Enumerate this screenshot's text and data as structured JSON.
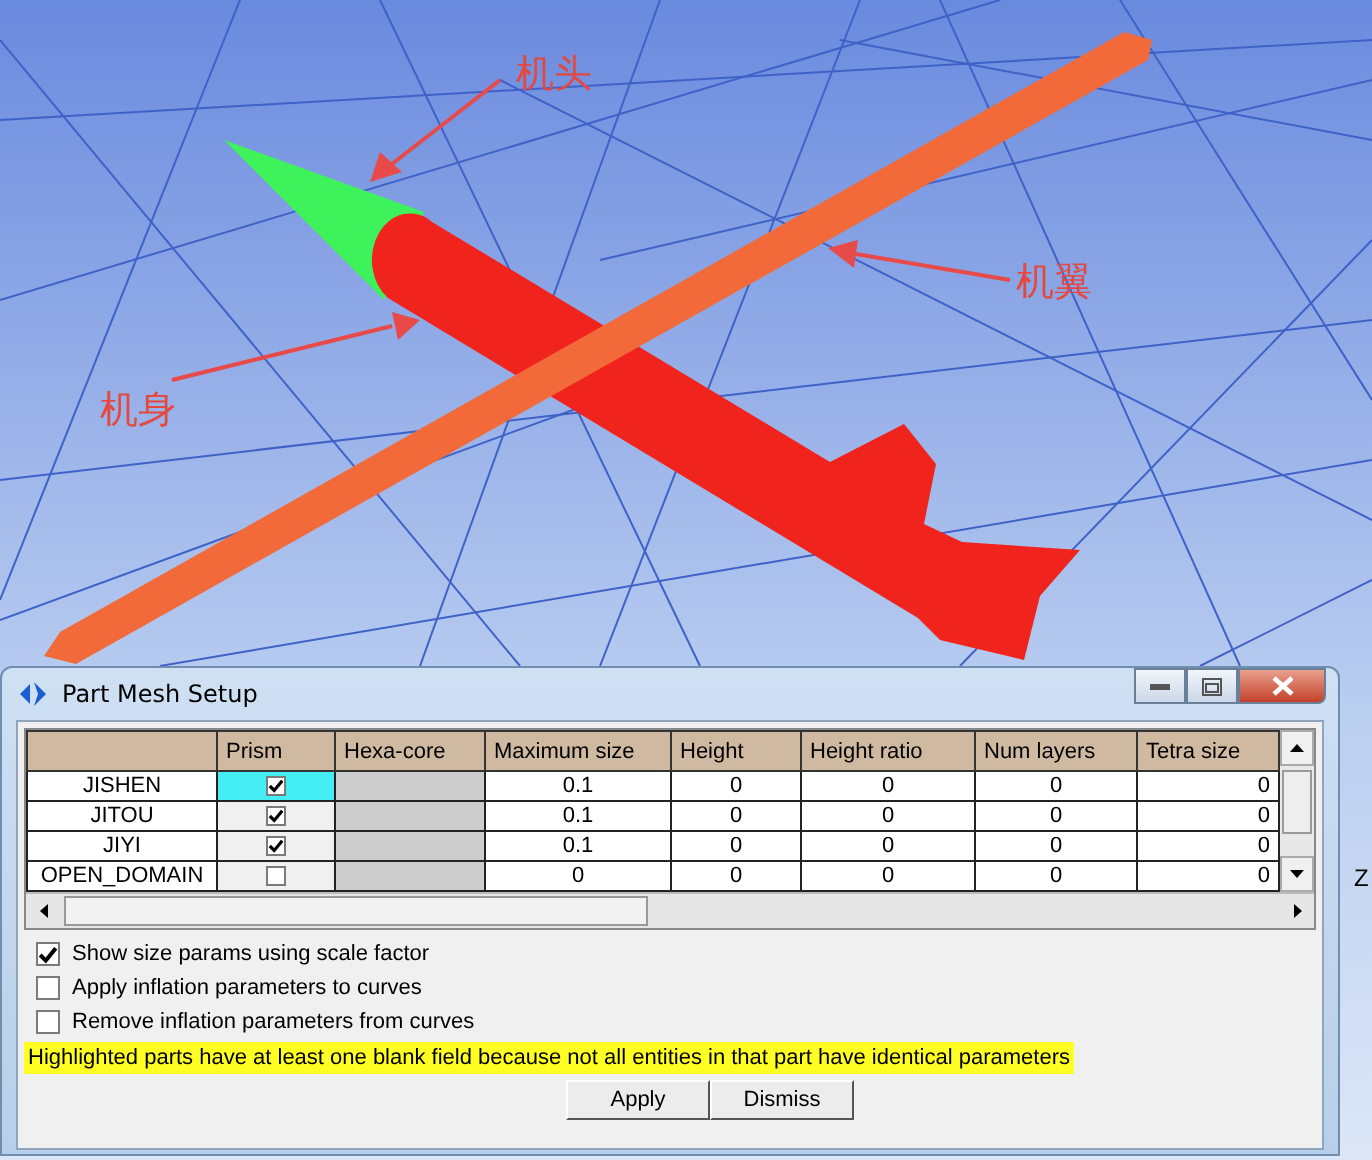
{
  "viewport": {
    "labels": [
      {
        "text": "机头"
      },
      {
        "text": "机翼"
      },
      {
        "text": "机身"
      }
    ],
    "axis_label": "Z"
  },
  "dialog": {
    "title": "Part Mesh Setup",
    "table": {
      "columns": [
        "Prism",
        "Hexa-core",
        "Maximum size",
        "Height",
        "Height ratio",
        "Num layers",
        "Tetra size"
      ],
      "rows": [
        {
          "name": "JISHEN",
          "selected": true,
          "prism": true,
          "cells": [
            "",
            "",
            "0.1",
            "0",
            "0",
            "0",
            "0"
          ]
        },
        {
          "name": "JITOU",
          "selected": false,
          "prism": true,
          "cells": [
            "",
            "",
            "0.1",
            "0",
            "0",
            "0",
            "0"
          ]
        },
        {
          "name": "JIYI",
          "selected": false,
          "prism": true,
          "cells": [
            "",
            "",
            "0.1",
            "0",
            "0",
            "0",
            "0"
          ]
        },
        {
          "name": "OPEN_DOMAIN",
          "selected": false,
          "prism": false,
          "cells": [
            "",
            "",
            "0",
            "0",
            "0",
            "0",
            "0"
          ]
        }
      ]
    },
    "checkboxes": [
      {
        "label": "Show size params using scale factor",
        "checked": true
      },
      {
        "label": "Apply inflation parameters to curves",
        "checked": false
      },
      {
        "label": "Remove inflation parameters from curves",
        "checked": false
      }
    ],
    "note": "Highlighted parts have at least one blank field because not all entities in that part have identical parameters",
    "buttons": [
      "Apply",
      "Dismiss"
    ]
  }
}
